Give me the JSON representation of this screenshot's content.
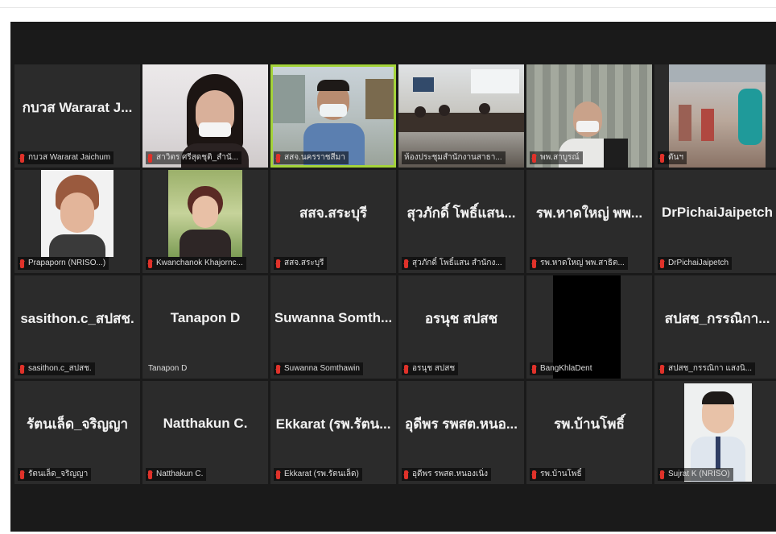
{
  "colors": {
    "active_border": "#a4d33a",
    "muted_mic": "#e0322a"
  },
  "participants": [
    {
      "center_name": "กบวส Wararat J...",
      "label": "กบวส Wararat Jaichum",
      "video": false
    },
    {
      "center_name": "",
      "label": "สาวิตร ศรีสุดชุติ_สำนั...",
      "video": true
    },
    {
      "center_name": "",
      "label": "สสจ.นครราชสีมา",
      "video": true,
      "active": true
    },
    {
      "center_name": "",
      "label": "ห้องประชุมสำนักงานสาธา...",
      "video": true
    },
    {
      "center_name": "",
      "label": "พพ.สาบูรณ์",
      "video": true
    },
    {
      "center_name": "",
      "label": "ดันฯ",
      "video": true
    },
    {
      "center_name": "",
      "label": "Prapaporn (NRISO...)",
      "video": true
    },
    {
      "center_name": "",
      "label": "Kwanchanok Khajornc...",
      "video": true
    },
    {
      "center_name": "สสจ.สระบุรี",
      "label": "สสจ.สระบุรี",
      "video": false
    },
    {
      "center_name": "สุวภักดิ์ โพธิ์แสน...",
      "label": "สุวภักดิ์ โพธิ์แสน สำนักง...",
      "video": false
    },
    {
      "center_name": "รพ.หาดใหญ่ พพ...",
      "label": "รพ.หาดใหญ่ พพ.สาธิต...",
      "video": false
    },
    {
      "center_name": "DrPichaiJaipetch",
      "label": "DrPichaiJaipetch",
      "video": false
    },
    {
      "center_name": "sasithon.c_สปสช.",
      "label": "sasithon.c_สปสช.",
      "video": false
    },
    {
      "center_name": "Tanapon D",
      "label": "Tanapon D",
      "video": false,
      "no_mic": true
    },
    {
      "center_name": "Suwanna Somth...",
      "label": "Suwanna Somthawin",
      "video": false
    },
    {
      "center_name": "อรนุช สปสช",
      "label": "อรนุช สปสช",
      "video": false
    },
    {
      "center_name": "",
      "label": "BangKhlaDent",
      "video": true
    },
    {
      "center_name": "สปสช_กรรณิกา...",
      "label": "สปสช_กรรณิกา แสงนิ...",
      "video": false
    },
    {
      "center_name": "รัตนเล็ด_จริญญา",
      "label": "รัตนเล็ด_จริญญา",
      "video": false
    },
    {
      "center_name": "Natthakun C.",
      "label": "Natthakun C.",
      "video": false
    },
    {
      "center_name": "Ekkarat (รพ.รัตน...",
      "label": "Ekkarat (รพ.รัตนเล็ด)",
      "video": false
    },
    {
      "center_name": "อุดีพร รพสต.หนอ...",
      "label": "อุดีพร รพสต.หนองเนิ่ง",
      "video": false
    },
    {
      "center_name": "รพ.บ้านโพธิ์",
      "label": "รพ.บ้านโพธิ์",
      "video": false
    },
    {
      "center_name": "",
      "label": "Sujrat K (NRISO)",
      "video": true
    }
  ]
}
